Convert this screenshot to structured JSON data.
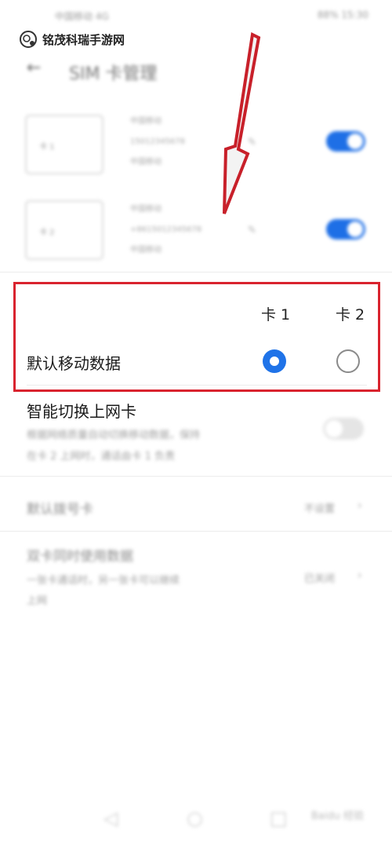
{
  "watermark": {
    "text": "铭茂科瑞手游网",
    "icon": "game-controller-icon"
  },
  "status_bar": {
    "left": "中国移动 4G",
    "right": "88% 15:30"
  },
  "header": {
    "back_icon": "back-arrow-icon",
    "title": "SIM 卡管理"
  },
  "sim_cards": [
    {
      "slot": "卡 1",
      "name": "中国移动",
      "number": "15012345678",
      "operator": "中国移动",
      "enabled": true
    },
    {
      "slot": "卡 2",
      "name": "中国移动",
      "number": "+8615012345678",
      "operator": "中国移动",
      "enabled": true
    }
  ],
  "data_section": {
    "col1": "卡 1",
    "col2": "卡 2",
    "row_label": "默认移动数据",
    "selected": "卡 1"
  },
  "smart_switch": {
    "title": "智能切换上网卡",
    "desc_line1": "根据网络质量自动切换移动数据，保持",
    "desc_line2": "在卡 2 上网时，通话由卡 1 负责",
    "enabled": false
  },
  "default_call": {
    "label": "默认拨号卡",
    "value": "不设置"
  },
  "dual_card": {
    "label": "双卡同时使用数据",
    "desc_line1": "一张卡通话时，另一张卡可以继续",
    "desc_line2": "上网",
    "value": "已关闭"
  },
  "colors": {
    "accent": "#1f73e8",
    "highlight": "#d9232e",
    "arrow": "#c8202a"
  },
  "nav_bar": {
    "back": "back-nav-icon",
    "home": "home-nav-icon",
    "recent": "recent-nav-icon"
  },
  "baidu_watermark": "Baidu 经验"
}
